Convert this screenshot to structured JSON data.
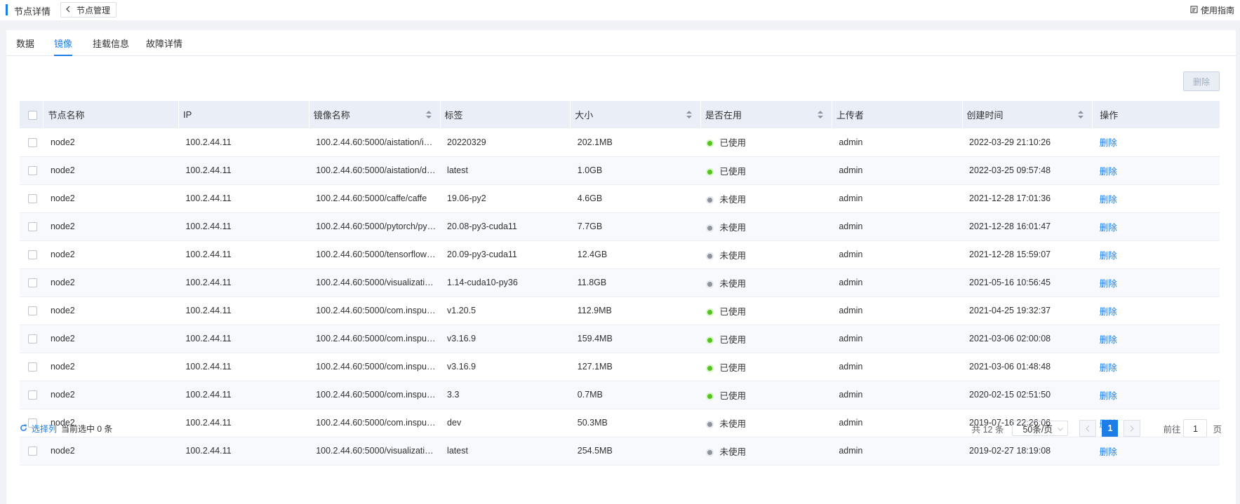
{
  "header": {
    "title": "节点详情",
    "back_label": "节点管理",
    "guide_label": "使用指南"
  },
  "tabs": [
    {
      "label": "数据",
      "active": false
    },
    {
      "label": "镜像",
      "active": true
    },
    {
      "label": "挂载信息",
      "active": false
    },
    {
      "label": "故障详情",
      "active": false
    }
  ],
  "toolbar": {
    "delete_label": "删除"
  },
  "table": {
    "columns": [
      "节点名称",
      "IP",
      "镜像名称",
      "标签",
      "大小",
      "是否在用",
      "上传者",
      "创建时间",
      "操作"
    ],
    "rows": [
      {
        "node": "node2",
        "ip": "100.2.44.11",
        "image": "100.2.44.60:5000/aistation/i…",
        "tag": "20220329",
        "size": "202.1MB",
        "status": "已使用",
        "in_use": true,
        "uploader": "admin",
        "created": "2022-03-29 21:10:26",
        "action": "删除"
      },
      {
        "node": "node2",
        "ip": "100.2.44.11",
        "image": "100.2.44.60:5000/aistation/d…",
        "tag": "latest",
        "size": "1.0GB",
        "status": "已使用",
        "in_use": true,
        "uploader": "admin",
        "created": "2022-03-25 09:57:48",
        "action": "删除"
      },
      {
        "node": "node2",
        "ip": "100.2.44.11",
        "image": "100.2.44.60:5000/caffe/caffe",
        "tag": "19.06-py2",
        "size": "4.6GB",
        "status": "未使用",
        "in_use": false,
        "uploader": "admin",
        "created": "2021-12-28 17:01:36",
        "action": "删除"
      },
      {
        "node": "node2",
        "ip": "100.2.44.11",
        "image": "100.2.44.60:5000/pytorch/py…",
        "tag": "20.08-py3-cuda11",
        "size": "7.7GB",
        "status": "未使用",
        "in_use": false,
        "uploader": "admin",
        "created": "2021-12-28 16:01:47",
        "action": "删除"
      },
      {
        "node": "node2",
        "ip": "100.2.44.11",
        "image": "100.2.44.60:5000/tensorflow…",
        "tag": "20.09-py3-cuda11",
        "size": "12.4GB",
        "status": "未使用",
        "in_use": false,
        "uploader": "admin",
        "created": "2021-12-28 15:59:07",
        "action": "删除"
      },
      {
        "node": "node2",
        "ip": "100.2.44.11",
        "image": "100.2.44.60:5000/visualizati…",
        "tag": "1.14-cuda10-py36",
        "size": "11.8GB",
        "status": "未使用",
        "in_use": false,
        "uploader": "admin",
        "created": "2021-05-16 10:56:45",
        "action": "删除"
      },
      {
        "node": "node2",
        "ip": "100.2.44.11",
        "image": "100.2.44.60:5000/com.inspu…",
        "tag": "v1.20.5",
        "size": "112.9MB",
        "status": "已使用",
        "in_use": true,
        "uploader": "admin",
        "created": "2021-04-25 19:32:37",
        "action": "删除"
      },
      {
        "node": "node2",
        "ip": "100.2.44.11",
        "image": "100.2.44.60:5000/com.inspu…",
        "tag": "v3.16.9",
        "size": "159.4MB",
        "status": "已使用",
        "in_use": true,
        "uploader": "admin",
        "created": "2021-03-06 02:00:08",
        "action": "删除"
      },
      {
        "node": "node2",
        "ip": "100.2.44.11",
        "image": "100.2.44.60:5000/com.inspu…",
        "tag": "v3.16.9",
        "size": "127.1MB",
        "status": "已使用",
        "in_use": true,
        "uploader": "admin",
        "created": "2021-03-06 01:48:48",
        "action": "删除"
      },
      {
        "node": "node2",
        "ip": "100.2.44.11",
        "image": "100.2.44.60:5000/com.inspu…",
        "tag": "3.3",
        "size": "0.7MB",
        "status": "已使用",
        "in_use": true,
        "uploader": "admin",
        "created": "2020-02-15 02:51:50",
        "action": "删除"
      },
      {
        "node": "node2",
        "ip": "100.2.44.11",
        "image": "100.2.44.60:5000/com.inspu…",
        "tag": "dev",
        "size": "50.3MB",
        "status": "未使用",
        "in_use": false,
        "uploader": "admin",
        "created": "2019-07-16 22:26:06",
        "action": "删除"
      },
      {
        "node": "node2",
        "ip": "100.2.44.11",
        "image": "100.2.44.60:5000/visualizati…",
        "tag": "latest",
        "size": "254.5MB",
        "status": "未使用",
        "in_use": false,
        "uploader": "admin",
        "created": "2019-02-27 18:19:08",
        "action": "删除"
      }
    ]
  },
  "footer": {
    "select_columns_label": "选择列",
    "selected_text": "当前选中 0 条",
    "total_text": "共 12 条",
    "page_size": "50条/页",
    "current_page": "1",
    "goto_label": "前往",
    "goto_value": "1",
    "page_unit": "页"
  },
  "colors": {
    "accent": "#1c7ee6",
    "in_use": "#52c41a",
    "not_in_use": "#8c939d",
    "header_bg": "#e9eef7"
  }
}
